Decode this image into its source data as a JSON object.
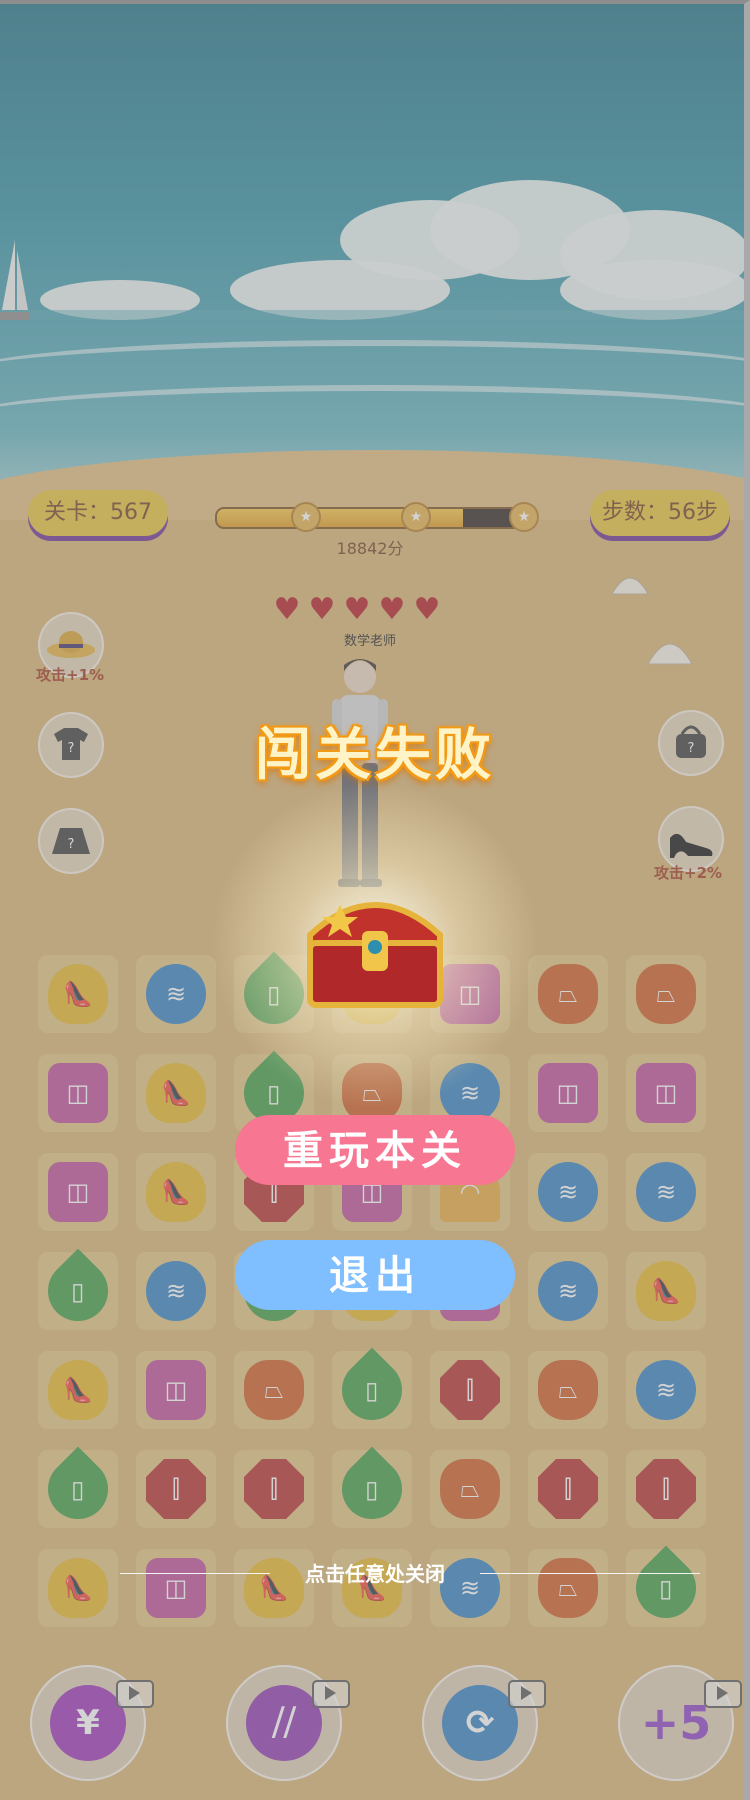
{
  "hud": {
    "level_label": "关卡：567",
    "steps_label": "步数：56步",
    "score_label": "18842分",
    "progress_fraction": 0.78,
    "progress_star_count": 3
  },
  "opponent": {
    "name": "数学老师",
    "hearts": 5
  },
  "left_slots": [
    {
      "icon": "sun-hat-icon",
      "bonus_label": "攻击+1%"
    },
    {
      "icon": "tshirt-unknown-icon",
      "bonus_label": ""
    },
    {
      "icon": "skirt-unknown-icon",
      "bonus_label": ""
    }
  ],
  "right_slots": [
    {
      "icon": "handbag-unknown-icon",
      "bonus_label": ""
    },
    {
      "icon": "high-heel-icon",
      "bonus_label": "攻击+2%"
    }
  ],
  "dialog": {
    "title": "闯关失败",
    "replay_label": "重玩本关",
    "exit_label": "退出",
    "close_hint": "点击任意处关闭"
  },
  "board": {
    "rows": [
      [
        "heel",
        "bag",
        "lotion",
        "heel",
        "perfume",
        "skirt",
        "skirt"
      ],
      [
        "perfume",
        "heel",
        "lotion",
        "skirt",
        "bag",
        "perfume",
        "perfume"
      ],
      [
        "perfume",
        "heel",
        "lipstick",
        "perfume",
        "shell",
        "bag",
        "bag"
      ],
      [
        "lotion",
        "bag",
        "lotion",
        "heel",
        "perfume",
        "bag",
        "heel"
      ],
      [
        "heel",
        "perfume",
        "skirt",
        "lotion",
        "lipstick",
        "skirt",
        "bag"
      ],
      [
        "lotion",
        "lipstick",
        "lipstick",
        "lotion",
        "skirt",
        "lipstick",
        "lipstick"
      ],
      [
        "heel",
        "perfume",
        "heel",
        "heel",
        "bag",
        "skirt",
        "lotion"
      ]
    ],
    "piece_styles": {
      "heel": {
        "icon": "high-heel-icon",
        "color": "#e5b624",
        "glyph": "👠"
      },
      "bag": {
        "icon": "tote-bag-icon",
        "color": "#2f7ec2",
        "glyph": "≋"
      },
      "lotion": {
        "icon": "lotion-bottle-icon",
        "color": "#3b9a3e",
        "glyph": "▯"
      },
      "perfume": {
        "icon": "perfume-bottle-icon",
        "color": "#bf4a98",
        "glyph": "◫"
      },
      "skirt": {
        "icon": "skirt-icon",
        "color": "#cf5a1f",
        "glyph": "⏢"
      },
      "lipstick": {
        "icon": "lipstick-icon",
        "color": "#b52a2a",
        "glyph": "⫿"
      },
      "shell": {
        "icon": "seashell-icon",
        "color": "#e7a73a",
        "glyph": "◠"
      }
    }
  },
  "powerups": [
    {
      "icon": "bomb-yuan-icon",
      "color": "#9b2fb8",
      "glyph": "¥"
    },
    {
      "icon": "hammer-break-icon",
      "color": "#8e36b2",
      "glyph": "⧸⧸"
    },
    {
      "icon": "shuffle-icon",
      "color": "#2f7ec2",
      "glyph": "⟳"
    },
    {
      "icon": "plus-five-steps-icon",
      "color": "#8b3fc4",
      "glyph": "+5"
    }
  ]
}
